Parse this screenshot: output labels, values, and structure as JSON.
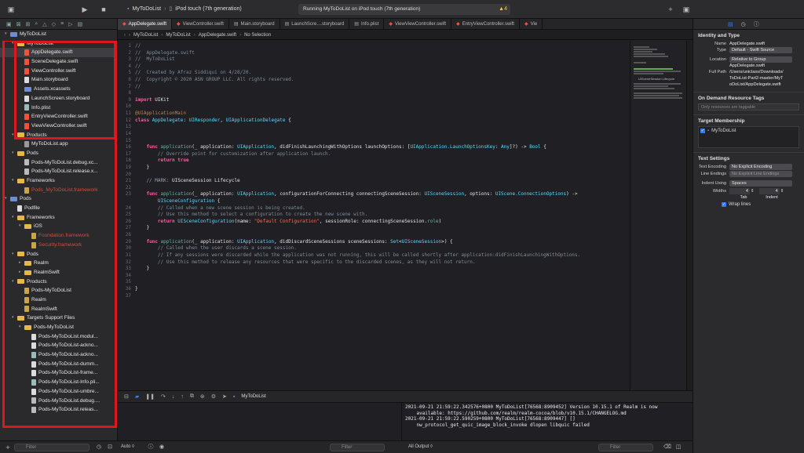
{
  "toolbar": {
    "scheme_project": "MyToDoList",
    "scheme_device": "iPod touch (7th generation)",
    "status": "Running MyToDoList on iPod touch (7th generation)",
    "warning_count": "4"
  },
  "tabs": [
    "AppDelegate.swift",
    "ViewController.swift",
    "Main.storyboard",
    "LaunchScre....storyboard",
    "Info.plist",
    "ViewViewController.swift",
    "EntryViewController.swift",
    "Vie"
  ],
  "jumpbar": [
    "MyToDoList",
    "MyToDoList",
    "AppDelegate.swift",
    "No Selection"
  ],
  "navigator": {
    "rows": [
      {
        "label": "MyToDoList",
        "icon": "blue",
        "indent": 0,
        "disc": "▾"
      },
      {
        "label": "MyToDoList",
        "icon": "folder",
        "indent": 1,
        "disc": "▾"
      },
      {
        "label": "AppDelegate.swift",
        "icon": "swift",
        "indent": 2,
        "sel": true
      },
      {
        "label": "SceneDelegate.swift",
        "icon": "swift",
        "indent": 2
      },
      {
        "label": "ViewController.swift",
        "icon": "swift",
        "indent": 2
      },
      {
        "label": "Main.storyboard",
        "icon": "file",
        "indent": 2
      },
      {
        "label": "Assets.xcassets",
        "icon": "blue",
        "indent": 2
      },
      {
        "label": "LaunchScreen.storyboard",
        "icon": "file",
        "indent": 2
      },
      {
        "label": "Info.plist",
        "icon": "plist",
        "indent": 2
      },
      {
        "label": "EntryViewController.swift",
        "icon": "swift",
        "indent": 2
      },
      {
        "label": "ViewViewController.swift",
        "icon": "swift",
        "indent": 2
      },
      {
        "label": "Products",
        "icon": "folder",
        "indent": 1,
        "disc": "▾"
      },
      {
        "label": "MyToDoList.app",
        "icon": "app",
        "indent": 2
      },
      {
        "label": "Pods",
        "icon": "folder",
        "indent": 1,
        "disc": "▾"
      },
      {
        "label": "Pods-MyToDoList.debug.xc...",
        "icon": "pod",
        "indent": 2
      },
      {
        "label": "Pods-MyToDoList.release.x...",
        "icon": "pod",
        "indent": 2
      },
      {
        "label": "Frameworks",
        "icon": "folder",
        "indent": 1,
        "disc": "▾"
      },
      {
        "label": "Pods_MyToDoList.framework",
        "icon": "fw",
        "indent": 2,
        "red": true
      },
      {
        "label": "Pods",
        "icon": "blue",
        "indent": 0,
        "disc": "▾"
      },
      {
        "label": "Podfile",
        "icon": "file",
        "indent": 1
      },
      {
        "label": "Frameworks",
        "icon": "folder",
        "indent": 1,
        "disc": "▾"
      },
      {
        "label": "iOS",
        "icon": "folder",
        "indent": 2,
        "disc": "▾"
      },
      {
        "label": "Foundation.framework",
        "icon": "fw",
        "indent": 3,
        "red": true
      },
      {
        "label": "Security.framework",
        "icon": "fw",
        "indent": 3,
        "red": true
      },
      {
        "label": "Pods",
        "icon": "folder",
        "indent": 1,
        "disc": "▾"
      },
      {
        "label": "Realm",
        "icon": "folder",
        "indent": 2,
        "disc": "▸"
      },
      {
        "label": "RealmSwift",
        "icon": "folder",
        "indent": 2,
        "disc": "▸"
      },
      {
        "label": "Products",
        "icon": "folder",
        "indent": 1,
        "disc": "▾"
      },
      {
        "label": "Pods-MyToDoList",
        "icon": "fw",
        "indent": 2
      },
      {
        "label": "Realm",
        "icon": "fw",
        "indent": 2
      },
      {
        "label": "RealmSwift",
        "icon": "fw",
        "indent": 2
      },
      {
        "label": "Targets Support Files",
        "icon": "folder",
        "indent": 1,
        "disc": "▾"
      },
      {
        "label": "Pods-MyToDoList",
        "icon": "folder",
        "indent": 2,
        "disc": "▾"
      },
      {
        "label": "Pods-MyToDoList.modul...",
        "icon": "file",
        "indent": 3
      },
      {
        "label": "Pods-MyToDoList-ackno...",
        "icon": "file",
        "indent": 3
      },
      {
        "label": "Pods-MyToDoList-ackno...",
        "icon": "plist",
        "indent": 3
      },
      {
        "label": "Pods-MyToDoList-dumm...",
        "icon": "file",
        "indent": 3
      },
      {
        "label": "Pods-MyToDoList-frame...",
        "icon": "file",
        "indent": 3
      },
      {
        "label": "Pods-MyToDoList-Info.pli...",
        "icon": "plist",
        "indent": 3
      },
      {
        "label": "Pods-MyToDoList-umbre...",
        "icon": "file",
        "indent": 3
      },
      {
        "label": "Pods-MyToDoList.debug....",
        "icon": "pod",
        "indent": 3
      },
      {
        "label": "Pods-MyToDoList.releas...",
        "icon": "pod",
        "indent": 3
      }
    ],
    "filter_placeholder": "Filter"
  },
  "code_lines": [
    {
      "n": "1",
      "parts": [
        [
          "c-com",
          "//"
        ]
      ]
    },
    {
      "n": "2",
      "parts": [
        [
          "c-com",
          "//  AppDelegate.swift"
        ]
      ]
    },
    {
      "n": "3",
      "parts": [
        [
          "c-com",
          "//  MyToDoList"
        ]
      ]
    },
    {
      "n": "4",
      "parts": [
        [
          "c-com",
          "//"
        ]
      ]
    },
    {
      "n": "5",
      "parts": [
        [
          "c-com",
          "//  Created by Afraz Siddiqui on 4/28/20."
        ]
      ]
    },
    {
      "n": "6",
      "parts": [
        [
          "c-com",
          "//  Copyright © 2020 ASN GROUP LLC. All rights reserved."
        ]
      ]
    },
    {
      "n": "7",
      "parts": [
        [
          "c-com",
          "//"
        ]
      ]
    },
    {
      "n": "8",
      "parts": []
    },
    {
      "n": "9",
      "parts": [
        [
          "c-kw",
          "import"
        ],
        [
          "code",
          " UIKit"
        ]
      ]
    },
    {
      "n": "10",
      "parts": []
    },
    {
      "n": "11",
      "parts": [
        [
          "c-attr",
          "@UIApplicationMain"
        ]
      ]
    },
    {
      "n": "12",
      "parts": [
        [
          "c-kw",
          "class"
        ],
        [
          "code",
          " "
        ],
        [
          "c-type",
          "AppDelegate"
        ],
        [
          "code",
          ": "
        ],
        [
          "c-type",
          "UIResponder"
        ],
        [
          "code",
          ", "
        ],
        [
          "c-type",
          "UIApplicationDelegate"
        ],
        [
          "code",
          " {"
        ]
      ]
    },
    {
      "n": "13",
      "parts": []
    },
    {
      "n": "14",
      "parts": []
    },
    {
      "n": "15",
      "parts": []
    },
    {
      "n": "16",
      "parts": [
        [
          "code",
          "    "
        ],
        [
          "c-kw",
          "func"
        ],
        [
          "code",
          " "
        ],
        [
          "c-fn",
          "application"
        ],
        [
          "code",
          "(_ application: "
        ],
        [
          "c-type",
          "UIApplication"
        ],
        [
          "code",
          ", didFinishLaunchingWithOptions launchOptions: ["
        ],
        [
          "c-type",
          "UIApplication.LaunchOptionsKey"
        ],
        [
          "code",
          ": "
        ],
        [
          "c-type",
          "Any"
        ],
        [
          "code",
          "]?) -> "
        ],
        [
          "c-type",
          "Bool"
        ],
        [
          "code",
          " {"
        ]
      ]
    },
    {
      "n": "17",
      "parts": [
        [
          "c-com",
          "        // Override point for customization after application launch."
        ]
      ]
    },
    {
      "n": "18",
      "parts": [
        [
          "code",
          "        "
        ],
        [
          "c-kw",
          "return"
        ],
        [
          "code",
          " "
        ],
        [
          "c-kw",
          "true"
        ]
      ]
    },
    {
      "n": "19",
      "parts": [
        [
          "code",
          "    }"
        ]
      ]
    },
    {
      "n": "20",
      "parts": []
    },
    {
      "n": "21",
      "parts": [
        [
          "c-mark",
          "    // MARK: "
        ],
        [
          "code",
          "UISceneSession Lifecycle"
        ]
      ]
    },
    {
      "n": "22",
      "parts": []
    },
    {
      "n": "23",
      "parts": [
        [
          "code",
          "    "
        ],
        [
          "c-kw",
          "func"
        ],
        [
          "code",
          " "
        ],
        [
          "c-fn",
          "application"
        ],
        [
          "code",
          "(_ application: "
        ],
        [
          "c-type",
          "UIApplication"
        ],
        [
          "code",
          ", configurationForConnecting connectingSceneSession: "
        ],
        [
          "c-type",
          "UISceneSession"
        ],
        [
          "code",
          ", options: "
        ],
        [
          "c-type",
          "UIScene.ConnectionOptions"
        ],
        [
          "code",
          ") ->"
        ]
      ]
    },
    {
      "n": "",
      "parts": [
        [
          "code",
          "        "
        ],
        [
          "c-type",
          "UISceneConfiguration"
        ],
        [
          "code",
          " {"
        ]
      ]
    },
    {
      "n": "24",
      "parts": [
        [
          "c-com",
          "        // Called when a new scene session is being created."
        ]
      ]
    },
    {
      "n": "25",
      "parts": [
        [
          "c-com",
          "        // Use this method to select a configuration to create the new scene with."
        ]
      ]
    },
    {
      "n": "26",
      "parts": [
        [
          "code",
          "        "
        ],
        [
          "c-kw",
          "return"
        ],
        [
          "code",
          " "
        ],
        [
          "c-type",
          "UISceneConfiguration"
        ],
        [
          "code",
          "(name: "
        ],
        [
          "c-str",
          "\"Default Configuration\""
        ],
        [
          "code",
          ", sessionRole: connectingSceneSession."
        ],
        [
          "c-fn",
          "role"
        ],
        [
          "code",
          ")"
        ]
      ]
    },
    {
      "n": "27",
      "parts": [
        [
          "code",
          "    }"
        ]
      ]
    },
    {
      "n": "28",
      "parts": []
    },
    {
      "n": "29",
      "parts": [
        [
          "code",
          "    "
        ],
        [
          "c-kw",
          "func"
        ],
        [
          "code",
          " "
        ],
        [
          "c-fn",
          "application"
        ],
        [
          "code",
          "(_ application: "
        ],
        [
          "c-type",
          "UIApplication"
        ],
        [
          "code",
          ", didDiscardSceneSessions sceneSessions: "
        ],
        [
          "c-type",
          "Set"
        ],
        [
          "code",
          "<"
        ],
        [
          "c-type",
          "UISceneSession"
        ],
        [
          "code",
          ">) {"
        ]
      ]
    },
    {
      "n": "30",
      "parts": [
        [
          "c-com",
          "        // Called when the user discards a scene session."
        ]
      ]
    },
    {
      "n": "31",
      "parts": [
        [
          "c-com",
          "        // If any sessions were discarded while the application was not running, this will be called shortly after application:didFinishLaunchingWithOptions."
        ]
      ]
    },
    {
      "n": "32",
      "parts": [
        [
          "c-com",
          "        // Use this method to release any resources that were specific to the discarded scenes, as they will not return."
        ]
      ]
    },
    {
      "n": "33",
      "parts": [
        [
          "code",
          "    }"
        ]
      ]
    },
    {
      "n": "34",
      "parts": []
    },
    {
      "n": "35",
      "parts": []
    },
    {
      "n": "36",
      "parts": [
        [
          "code",
          "}"
        ]
      ]
    },
    {
      "n": "37",
      "parts": []
    }
  ],
  "minimap_label": "UISceneSession Lifecycle",
  "debug": {
    "target": "MyToDoList",
    "console": "2021-09-21 21:59:22.342576+0800 MyToDoList[76568:8909452] Version 10.15.1 of Realm is now\n    available: https://github.com/realm/realm-cocoa/blob/v10.15.1/CHANGELOG.md\n2021-09-21 21:59:22.590259+0800 MyToDoList[76568:8909447] []\n    nw_protocol_get_quic_image_block_invoke dlopen libquic failed",
    "auto_label": "Auto ◊",
    "output_label": "All Output ◊",
    "filter_placeholder": "Filter"
  },
  "inspector": {
    "identity_title": "Identity and Type",
    "name_label": "Name",
    "name_value": "AppDelegate.swift",
    "type_label": "Type",
    "type_value": "Default - Swift Source",
    "location_label": "Location",
    "location_value": "Relative to Group",
    "location_file": "AppDelegate.swift",
    "fullpath_label": "Full Path",
    "fullpath_value": "/Users/uniclass/Downloads/ToDoList-Part2-master/MyToDoList/AppDelegate.swift",
    "odr_title": "On Demand Resource Tags",
    "odr_placeholder": "Only resources are taggable",
    "tm_title": "Target Membership",
    "tm_target": "MyToDoList",
    "ts_title": "Text Settings",
    "enc_label": "Text Encoding",
    "enc_value": "No Explicit Encoding",
    "le_label": "Line Endings",
    "le_value": "No Explicit Line Endings",
    "indent_label": "Indent Using",
    "indent_value": "Spaces",
    "widths_label": "Widths",
    "tab_width": "4",
    "indent_width": "4",
    "tab_label": "Tab",
    "indent_sub_label": "Indent",
    "wrap_label": "Wrap lines"
  }
}
